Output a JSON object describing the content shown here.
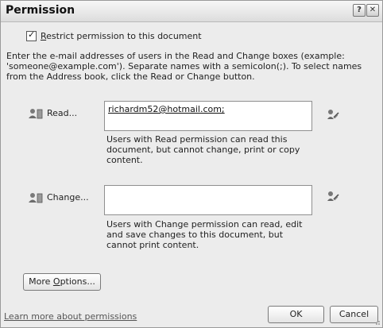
{
  "dialog": {
    "title": "Permission",
    "help_glyph": "?",
    "close_glyph": "✕"
  },
  "restrict": {
    "checked": true,
    "label_first": "R",
    "label_rest": "estrict permission to this document"
  },
  "intro_text": "Enter the e-mail addresses of users in the Read and Change boxes (example: 'someone@example.com'). Separate names with a semicolon(;). To select names from the Address book, click the Read or Change button.",
  "read": {
    "label": "Read...",
    "value": "richardm52@hotmail.com;",
    "help": "Users with Read permission can read this document, but cannot change, print or copy content."
  },
  "change": {
    "label": "Change...",
    "value": "",
    "help": "Users with Change permission can read, edit and save changes to this document, but cannot print content."
  },
  "buttons": {
    "more_options_prefix": "More ",
    "more_options_underlined": "O",
    "more_options_suffix": "ptions...",
    "ok": "OK",
    "cancel": "Cancel"
  },
  "learn_more": "Learn more about permissions",
  "icons": {
    "read_person": "person-icon",
    "change_person": "person-icon",
    "read_book": "address-book-icon",
    "change_book": "address-book-icon"
  }
}
